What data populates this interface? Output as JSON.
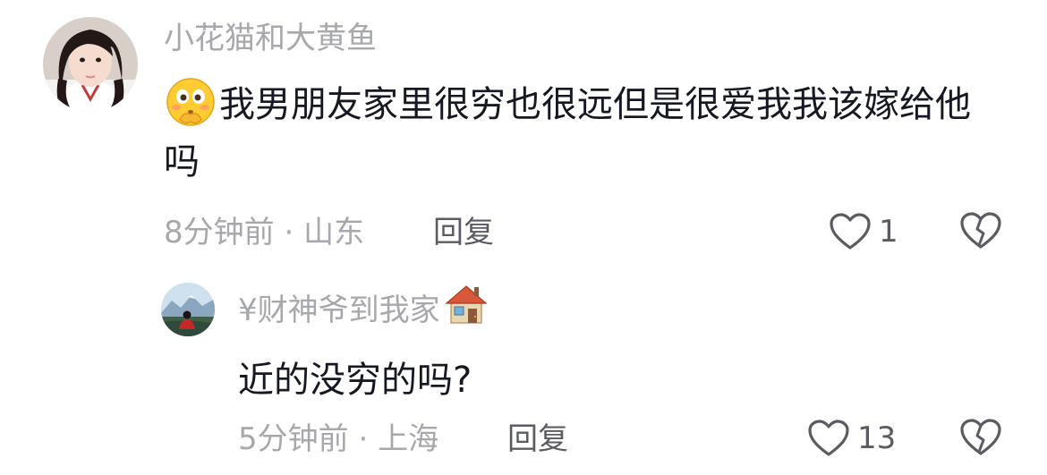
{
  "comments": [
    {
      "username": "小花猫和大黄鱼",
      "text": "我男朋友家里很穷也很远但是很爱我我该嫁给他吗",
      "emoji": "shy-face-emoji",
      "time": "8分钟前",
      "separator": "·",
      "location": "山东",
      "reply_label": "回复",
      "likes": "1"
    },
    {
      "username": "¥财神爷到我家",
      "username_emoji": "house-emoji",
      "text": "近的没穷的吗?",
      "time": "5分钟前",
      "separator": "·",
      "location": "上海",
      "reply_label": "回复",
      "likes": "13"
    }
  ],
  "colors": {
    "muted": "#a7a8ad",
    "text": "#161823",
    "action": "#5b5c63"
  }
}
